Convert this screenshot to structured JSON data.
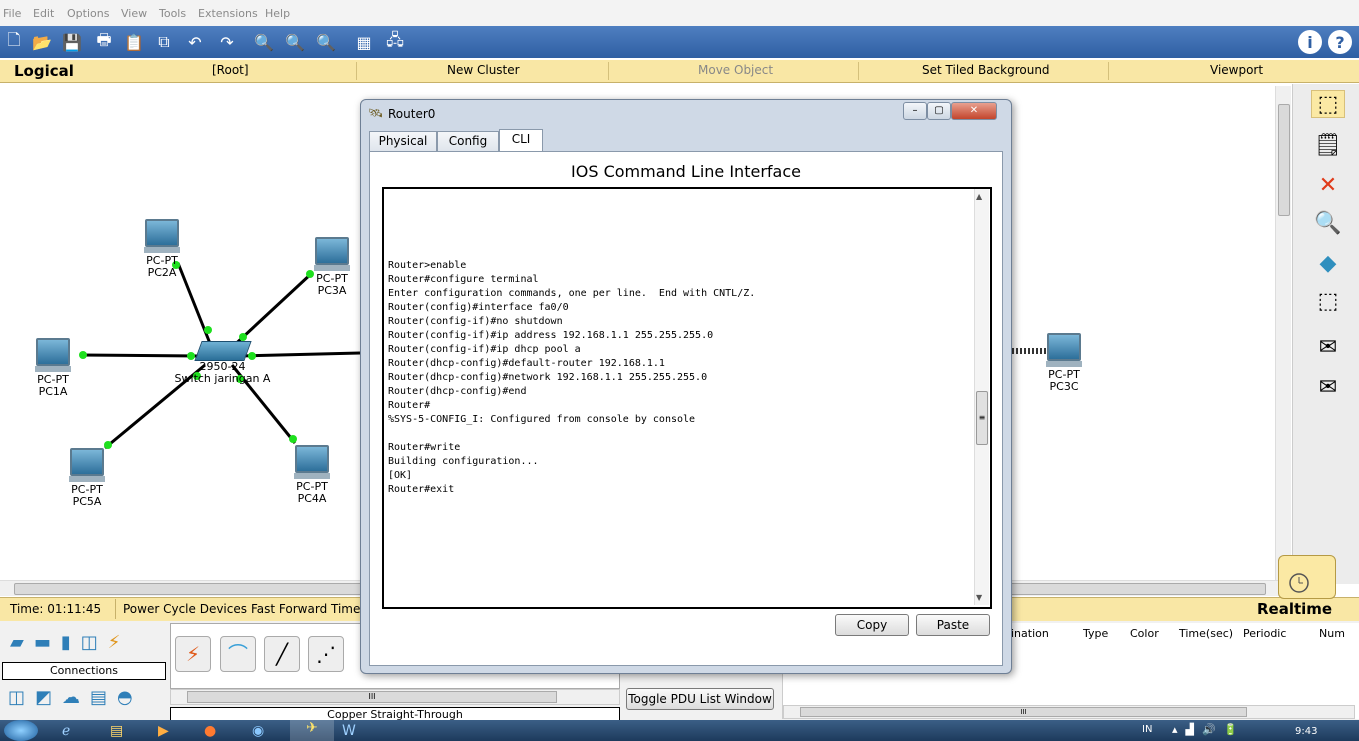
{
  "menu": [
    "File",
    "Edit",
    "Options",
    "View",
    "Tools",
    "Extensions",
    "Help"
  ],
  "logical_bar": {
    "mode": "Logical",
    "items": [
      "[Root]",
      "New Cluster",
      "Move Object",
      "Set Tiled Background",
      "Viewport"
    ]
  },
  "devices": [
    {
      "type": "PC-PT",
      "name": "PC2A"
    },
    {
      "type": "PC-PT",
      "name": "PC3A"
    },
    {
      "type": "PC-PT",
      "name": "PC1A"
    },
    {
      "type": "PC-PT",
      "name": "PC5A"
    },
    {
      "type": "PC-PT",
      "name": "PC4A"
    },
    {
      "type": "PC-PT",
      "name": "PC3C"
    }
  ],
  "switch": {
    "model": "2950-24",
    "name": "Switch jaringan A"
  },
  "status": {
    "time": "Time: 01:11:45",
    "power_cycle": "Power Cycle Devices",
    "fast_forward": "Fast Forward Time",
    "mode": "Realtime"
  },
  "bottom": {
    "connections_label": "Connections",
    "cable_label": "Copper Straight-Through",
    "toggle_pdu": "Toggle PDU List Window",
    "scroll_grip": "III",
    "pdu_columns": [
      "ination",
      "Type",
      "Color",
      "Time(sec)",
      "Periodic",
      "Num"
    ]
  },
  "taskbar": {
    "lang": "IN",
    "clock": "9:43"
  },
  "router_window": {
    "title": "Router0",
    "tabs": [
      "Physical",
      "Config",
      "CLI"
    ],
    "active_tab": "CLI",
    "heading": "IOS Command Line Interface",
    "cli_lines": [
      "Router>enable",
      "Router#configure terminal",
      "Enter configuration commands, one per line.  End with CNTL/Z.",
      "Router(config)#interface fa0/0",
      "Router(config-if)#no shutdown",
      "Router(config-if)#ip address 192.168.1.1 255.255.255.0",
      "Router(config-if)#ip dhcp pool a",
      "Router(dhcp-config)#default-router 192.168.1.1",
      "Router(dhcp-config)#network 192.168.1.1 255.255.255.0",
      "Router(dhcp-config)#end",
      "Router#",
      "%SYS-5-CONFIG_I: Configured from console by console",
      "",
      "Router#write",
      "Building configuration...",
      "[OK]",
      "Router#exit"
    ],
    "copy_label": "Copy",
    "paste_label": "Paste"
  },
  "colors": {
    "toolbar": "#3a6aae",
    "logical_bar": "#f9e7a5",
    "link_dot": "#1ee01e"
  }
}
